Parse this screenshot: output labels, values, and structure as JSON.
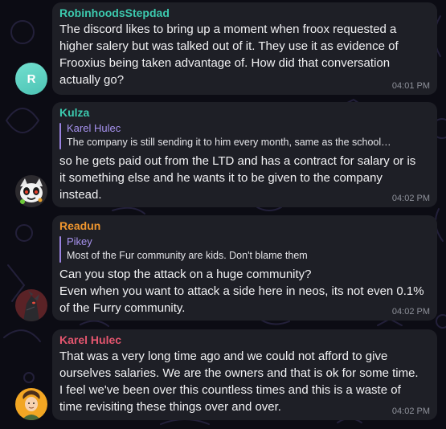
{
  "colors": {
    "background": "#0c0c14",
    "bubble": "#1e1f26",
    "reply_accent": "#9a83e0",
    "timestamp": "#8d9099"
  },
  "messages": [
    {
      "sender": "RobinhoodsStepdad",
      "sender_color": "#3cc9ae",
      "avatar_initial": "R",
      "text": "The discord likes to bring up a moment when froox requested a higher salery but was talked out of it. They use it as evidence of Frooxius being taken advantage of. How did that conversation actually go?",
      "time": "04:01 PM"
    },
    {
      "sender": "Kulza",
      "sender_color": "#3cc9ae",
      "avatar_icon": "furry-character-avatar",
      "reply": {
        "author": "Karel Hulec",
        "text": "The company is still sending it to him every month, same as the school…"
      },
      "text": "so he gets paid out from the LTD and has a contract for salary or is it something else and he wants it to be given to the company instead.",
      "time": "04:02 PM"
    },
    {
      "sender": "Readun",
      "sender_color": "#f0962e",
      "avatar_icon": "dragon-avatar",
      "reply": {
        "author": "Pikey",
        "text": "Most of the Fur community are kids. Don't blame them"
      },
      "text": "Can you stop the attack on a huge community?\nEven when you want to attack a side here in neos, its not even 0.1% of the Furry community.",
      "time": "04:02 PM"
    },
    {
      "sender": "Karel Hulec",
      "sender_color": "#e5566f",
      "avatar_icon": "cartoon-portrait-avatar",
      "text": "That was a very long time ago and we could not afford to give ourselves salaries. We are the owners and that is ok for some time. I feel we've been over this countless times and this is a waste of time revisiting these things over and over.",
      "time": "04:02 PM"
    }
  ]
}
